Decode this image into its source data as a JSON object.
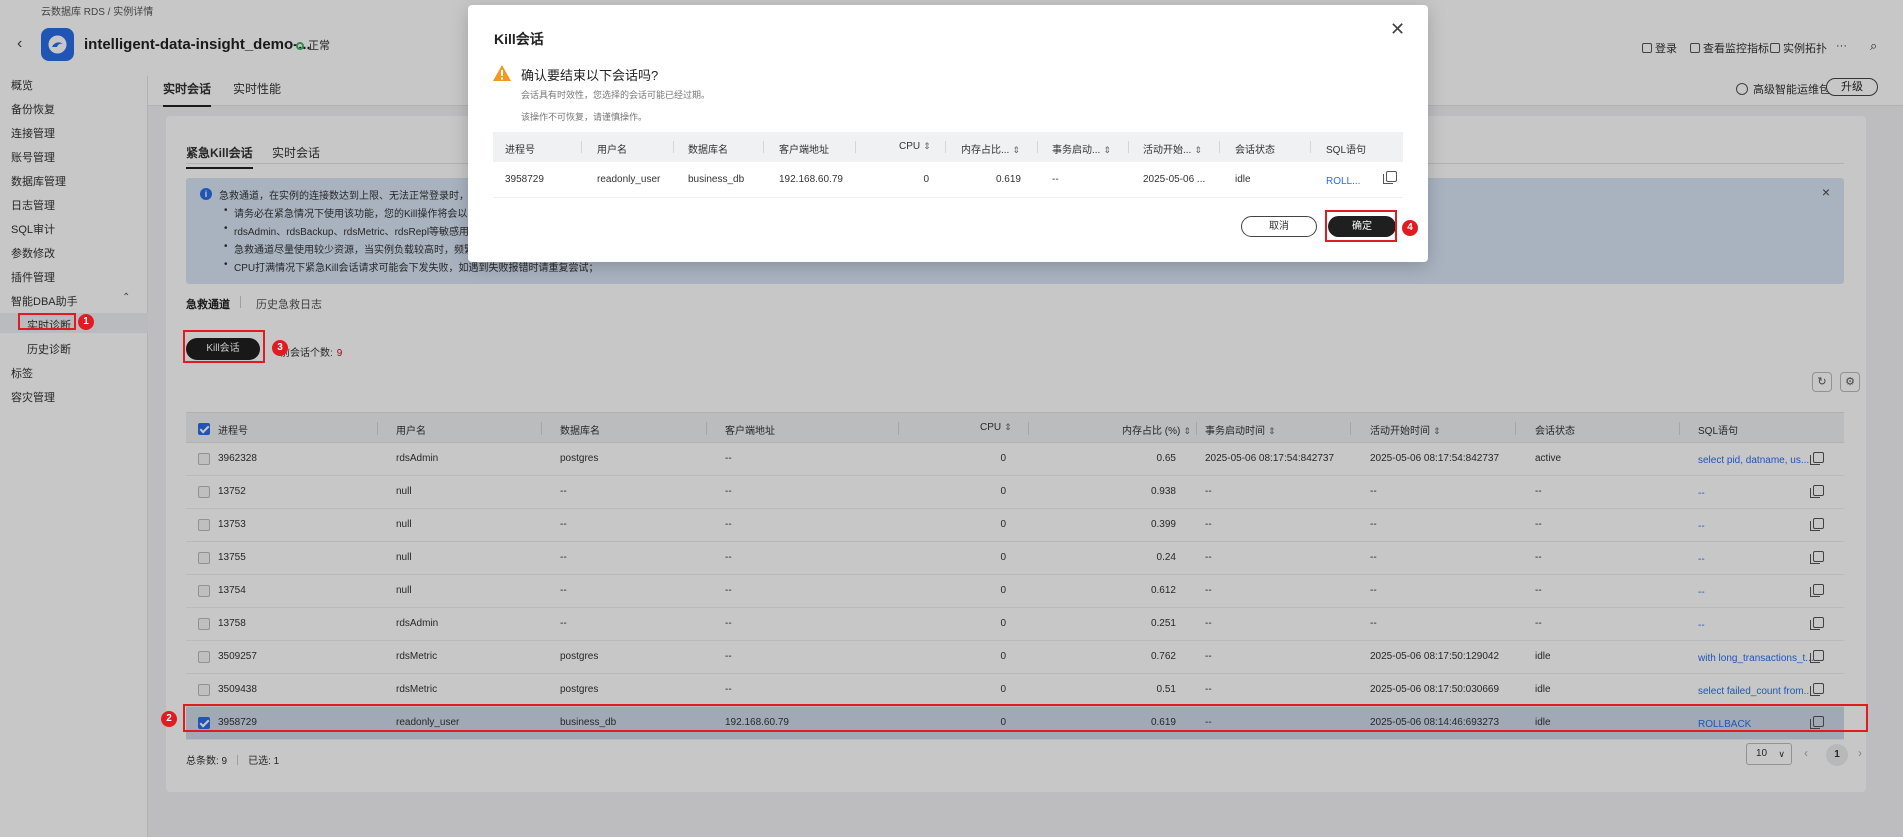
{
  "breadcrumb": "云数据库 RDS / 实例详情",
  "instance": {
    "name": "intelligent-data-insight_demo-...",
    "status": "正常"
  },
  "header_actions": [
    "登录",
    "查看监控指标",
    "实例拓扑",
    "···"
  ],
  "sidebar": {
    "items": [
      "概览",
      "备份恢复",
      "连接管理",
      "账号管理",
      "数据库管理",
      "日志管理",
      "SQL审计",
      "参数修改",
      "插件管理",
      "智能DBA助手",
      "实时诊断",
      "历史诊断",
      "标签",
      "容灾管理"
    ]
  },
  "top_tabs": [
    "实时会话",
    "实时性能"
  ],
  "premium": {
    "label": "高级智能运维包",
    "upgrade": "升级"
  },
  "inner_tabs": [
    "紧急Kill会话",
    "实时会话"
  ],
  "info": {
    "line1": "急救通道，在实例的连接数达到上限、无法正常登录时，该",
    "bullets": [
      "请务必在紧急情况下使用该功能，您的Kill操作将会以日志",
      "rdsAdmin、rdsBackup、rdsMetric、rdsRepl等敏感用户",
      "急救通道尽量使用较少资源，当实例负载较高时，频繁刷",
      "CPU打满情况下紧急Kill会话请求可能会下发失败，如遇到失败报错时请重复尝试；"
    ]
  },
  "sub_tabs": [
    "急救通道",
    "历史急救日志"
  ],
  "kill_button": "Kill会话",
  "session_count": {
    "label": "前会话个数:",
    "value": "9"
  },
  "table": {
    "columns": [
      "进程号",
      "用户名",
      "数据库名",
      "客户端地址",
      "CPU",
      "内存占比 (%)",
      "事务启动时间",
      "活动开始时间",
      "会话状态",
      "SQL语句"
    ],
    "rows": [
      {
        "pid": "3962328",
        "user": "rdsAdmin",
        "db": "postgres",
        "client": "--",
        "cpu": "0",
        "mem": "0.65",
        "txn": "2025-05-06 08:17:54:842737",
        "act": "2025-05-06 08:17:54:842737",
        "state": "active",
        "sql": "select pid, datname, us...",
        "checked": false
      },
      {
        "pid": "13752",
        "user": "null",
        "db": "--",
        "client": "--",
        "cpu": "0",
        "mem": "0.938",
        "txn": "--",
        "act": "--",
        "state": "--",
        "sql": "--",
        "checked": false
      },
      {
        "pid": "13753",
        "user": "null",
        "db": "--",
        "client": "--",
        "cpu": "0",
        "mem": "0.399",
        "txn": "--",
        "act": "--",
        "state": "--",
        "sql": "--",
        "checked": false
      },
      {
        "pid": "13755",
        "user": "null",
        "db": "--",
        "client": "--",
        "cpu": "0",
        "mem": "0.24",
        "txn": "--",
        "act": "--",
        "state": "--",
        "sql": "--",
        "checked": false
      },
      {
        "pid": "13754",
        "user": "null",
        "db": "--",
        "client": "--",
        "cpu": "0",
        "mem": "0.612",
        "txn": "--",
        "act": "--",
        "state": "--",
        "sql": "--",
        "checked": false
      },
      {
        "pid": "13758",
        "user": "rdsAdmin",
        "db": "--",
        "client": "--",
        "cpu": "0",
        "mem": "0.251",
        "txn": "--",
        "act": "--",
        "state": "--",
        "sql": "--",
        "checked": false
      },
      {
        "pid": "3509257",
        "user": "rdsMetric",
        "db": "postgres",
        "client": "--",
        "cpu": "0",
        "mem": "0.762",
        "txn": "--",
        "act": "2025-05-06 08:17:50:129042",
        "state": "idle",
        "sql": "with long_transactions_t...",
        "checked": false
      },
      {
        "pid": "3509438",
        "user": "rdsMetric",
        "db": "postgres",
        "client": "--",
        "cpu": "0",
        "mem": "0.51",
        "txn": "--",
        "act": "2025-05-06 08:17:50:030669",
        "state": "idle",
        "sql": "select failed_count from...",
        "checked": false
      },
      {
        "pid": "3958729",
        "user": "readonly_user",
        "db": "business_db",
        "client": "192.168.60.79",
        "cpu": "0",
        "mem": "0.619",
        "txn": "--",
        "act": "2025-05-06 08:14:46:693273",
        "state": "idle",
        "sql": "ROLLBACK",
        "checked": true
      }
    ]
  },
  "footer": {
    "total": "总条数: 9",
    "selected": "已选: 1",
    "page_size": "10",
    "page": "1"
  },
  "modal": {
    "title": "Kill会话",
    "question": "确认要结束以下会话吗?",
    "note1": "会话具有时效性，您选择的会话可能已经过期。",
    "note2": "该操作不可恢复，请谨慎操作。",
    "columns": [
      "进程号",
      "用户名",
      "数据库名",
      "客户端地址",
      "CPU",
      "内存占比...",
      "事务启动...",
      "活动开始...",
      "会话状态",
      "SQL语句"
    ],
    "row": {
      "pid": "3958729",
      "user": "readonly_user",
      "db": "business_db",
      "client": "192.168.60.79",
      "cpu": "0",
      "mem": "0.619",
      "txn": "--",
      "act": "2025-05-06 ...",
      "state": "idle",
      "sql": "ROLL..."
    },
    "cancel": "取消",
    "confirm": "确定"
  },
  "annotations": [
    "1",
    "2",
    "3",
    "4"
  ],
  "colors": {
    "accent": "#2a6ee8",
    "annotation": "#e11b22",
    "primary_button": "#1f1f1f",
    "info_bg": "#d9e6f7"
  }
}
